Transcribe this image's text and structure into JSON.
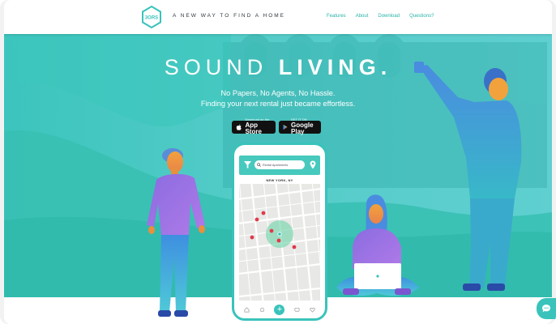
{
  "brand": {
    "logo_text": "3ORS",
    "tagline": "A NEW WAY TO FIND A HOME",
    "accent_color": "#39c3bb",
    "hero_bg": "#4fcac5"
  },
  "nav": {
    "items": [
      {
        "label": "Features"
      },
      {
        "label": "About"
      },
      {
        "label": "Download"
      },
      {
        "label": "Questions?"
      }
    ]
  },
  "hero": {
    "headline_light": "SOUND ",
    "headline_bold": "LIVING.",
    "subline1": "No Papers, No Agents, No Hassle.",
    "subline2": "Finding your next rental just became effortless."
  },
  "stores": {
    "apple": {
      "small": "Download on the",
      "big": "App Store",
      "icon": "apple-icon"
    },
    "google": {
      "small": "GET IT ON",
      "big": "Google Play",
      "icon": "play-icon"
    }
  },
  "phone": {
    "search_placeholder": "Rental Apartments",
    "city": "NEW YORK, NY",
    "tab_icons": [
      "home-icon",
      "bell-icon",
      "plus-icon",
      "chat-icon",
      "heart-icon"
    ],
    "fab_label": "+"
  },
  "chat_widget": {
    "icon": "chat-bubble-icon"
  }
}
